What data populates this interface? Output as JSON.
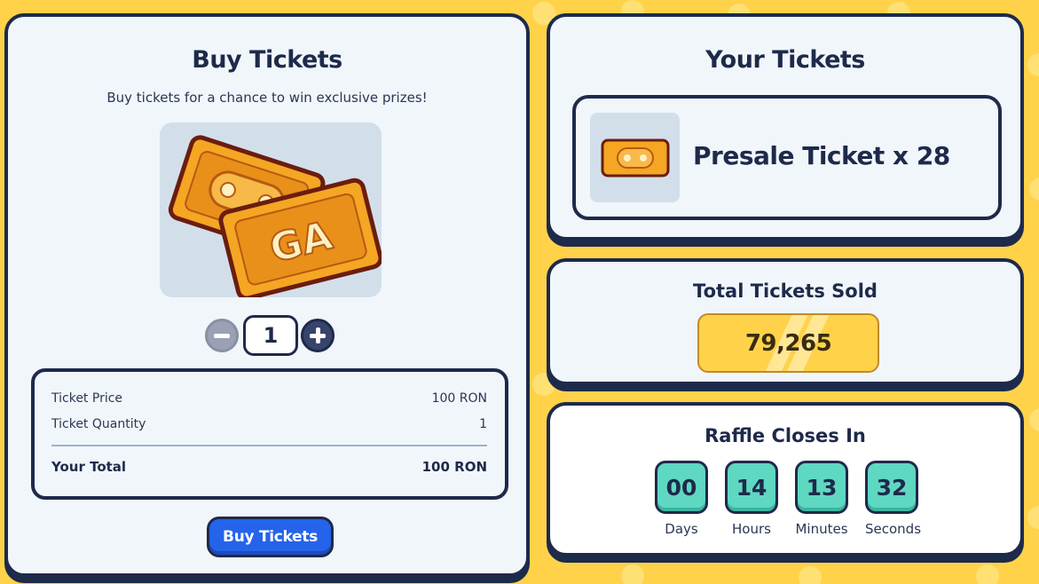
{
  "buy_panel": {
    "title": "Buy Tickets",
    "subtitle": "Buy tickets for a chance to win exclusive prizes!",
    "quantity": "1",
    "summary": {
      "price_label": "Ticket Price",
      "price_value": "100 RON",
      "qty_label": "Ticket Quantity",
      "qty_value": "1",
      "total_label": "Your Total",
      "total_value": "100 RON"
    },
    "buy_button": "Buy Tickets",
    "art_text": "GA"
  },
  "your_tickets": {
    "title": "Your Tickets",
    "item_label": "Presale Ticket x 28"
  },
  "total_sold": {
    "title": "Total Tickets Sold",
    "value": "79,265"
  },
  "raffle": {
    "title": "Raffle Closes In",
    "countdown": [
      {
        "value": "00",
        "label": "Days"
      },
      {
        "value": "14",
        "label": "Hours"
      },
      {
        "value": "13",
        "label": "Minutes"
      },
      {
        "value": "32",
        "label": "Seconds"
      }
    ]
  },
  "colors": {
    "background": "#ffd24a",
    "panel": "#f1f6fb",
    "outline": "#1e2a4a",
    "button_blue": "#2563eb",
    "countdown_teal": "#5fd8c2",
    "ticket_orange": "#f5a623"
  },
  "icons": {
    "minus": "minus-icon",
    "plus": "plus-icon",
    "ticket_art": "ticket-illustration",
    "presale_ticket": "presale-ticket-icon"
  }
}
